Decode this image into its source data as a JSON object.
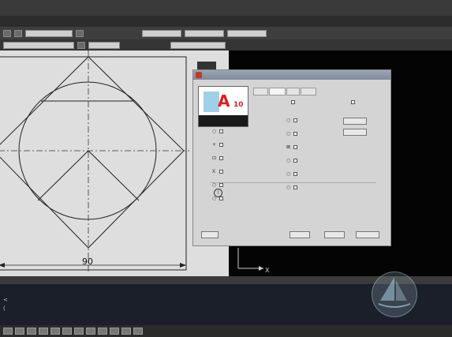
{
  "colors": {
    "drawing_bg": "#dedede",
    "model_bg": "#040404",
    "dialog_bg": "#d4d4d4",
    "preview_accent": "#e31b1b",
    "cmd_text": "#c9c9ff"
  },
  "drawing": {
    "dimension": "90",
    "axis_x": "X"
  },
  "dialog": {
    "preview_big": "A",
    "preview_sub": "10",
    "options_left": [
      {
        "mark": "○",
        "label": ""
      },
      {
        "mark": "+",
        "label": ""
      },
      {
        "mark": "⊡",
        "label": ""
      },
      {
        "mark": "X",
        "label": ""
      },
      {
        "mark": "○",
        "label": ""
      },
      {
        "mark": "○",
        "label": ""
      }
    ],
    "options_right": [
      {
        "mark": "○",
        "label": ""
      },
      {
        "mark": "○",
        "label": ""
      },
      {
        "mark": "⊠",
        "label": ""
      },
      {
        "mark": "○",
        "label": ""
      },
      {
        "mark": "○",
        "label": ""
      },
      {
        "mark": "○",
        "label": ""
      }
    ]
  },
  "command_line": {
    "line2": "<",
    "line3": "("
  },
  "icons": [
    "square-icon",
    "info-icon",
    "cross-icon",
    "circle-icon",
    "crosshair-icon",
    "arrow-icon"
  ]
}
